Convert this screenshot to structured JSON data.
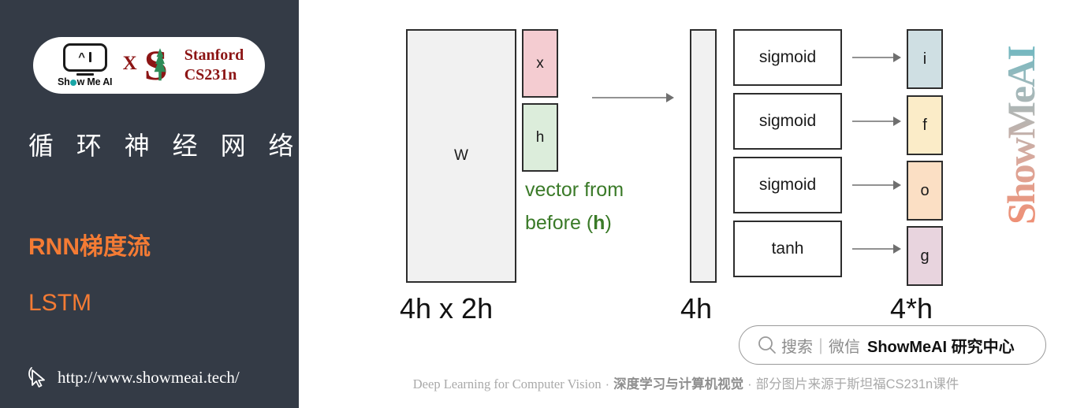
{
  "sidebar": {
    "badge": {
      "brand_name": "Show Me AI",
      "separator": "X",
      "partner_line1": "Stanford",
      "partner_line2": "CS231n"
    },
    "title": "循 环 神 经 网 络",
    "menu": [
      {
        "label": "RNN梯度流"
      },
      {
        "label": "LSTM"
      }
    ],
    "url": "http://www.showmeai.tech/"
  },
  "diagram": {
    "weight_box_label": "W",
    "input_x_label": "x",
    "input_h_label": "h",
    "vector_note_line1": "vector from",
    "vector_note_line2_pre": "before (",
    "vector_note_line2_bold": "h",
    "vector_note_line2_post": ")",
    "stack_4h_label": "",
    "gates": [
      {
        "activation": "sigmoid",
        "output": "i"
      },
      {
        "activation": "sigmoid",
        "output": "f"
      },
      {
        "activation": "sigmoid",
        "output": "o"
      },
      {
        "activation": "tanh",
        "output": "g"
      }
    ],
    "dimensions": {
      "weight": "4h x 2h",
      "preactivation": "4h",
      "output": "4*h"
    },
    "colors": {
      "x_fill": "#f4ccd1",
      "h_fill": "#dceddb",
      "i_fill": "#cfdfe3",
      "f_fill": "#fbecc8",
      "o_fill": "#fbdfc4",
      "g_fill": "#e8d4de",
      "note_green": "#3a7a28",
      "accent_orange": "#f47b34",
      "sidebar_bg": "#343b46",
      "stanford_red": "#8c1515"
    }
  },
  "search_widget": {
    "placeholder": "搜索｜微信",
    "brand": "ShowMeAI 研究中心"
  },
  "footer": {
    "english": "Deep Learning for Computer Vision",
    "sep1": "·",
    "chinese_bold": "深度学习与计算机视觉",
    "sep2": "·",
    "chinese_note": "部分图片来源于斯坦福CS231n课件"
  },
  "watermark": {
    "text": "ShowMeAI"
  }
}
